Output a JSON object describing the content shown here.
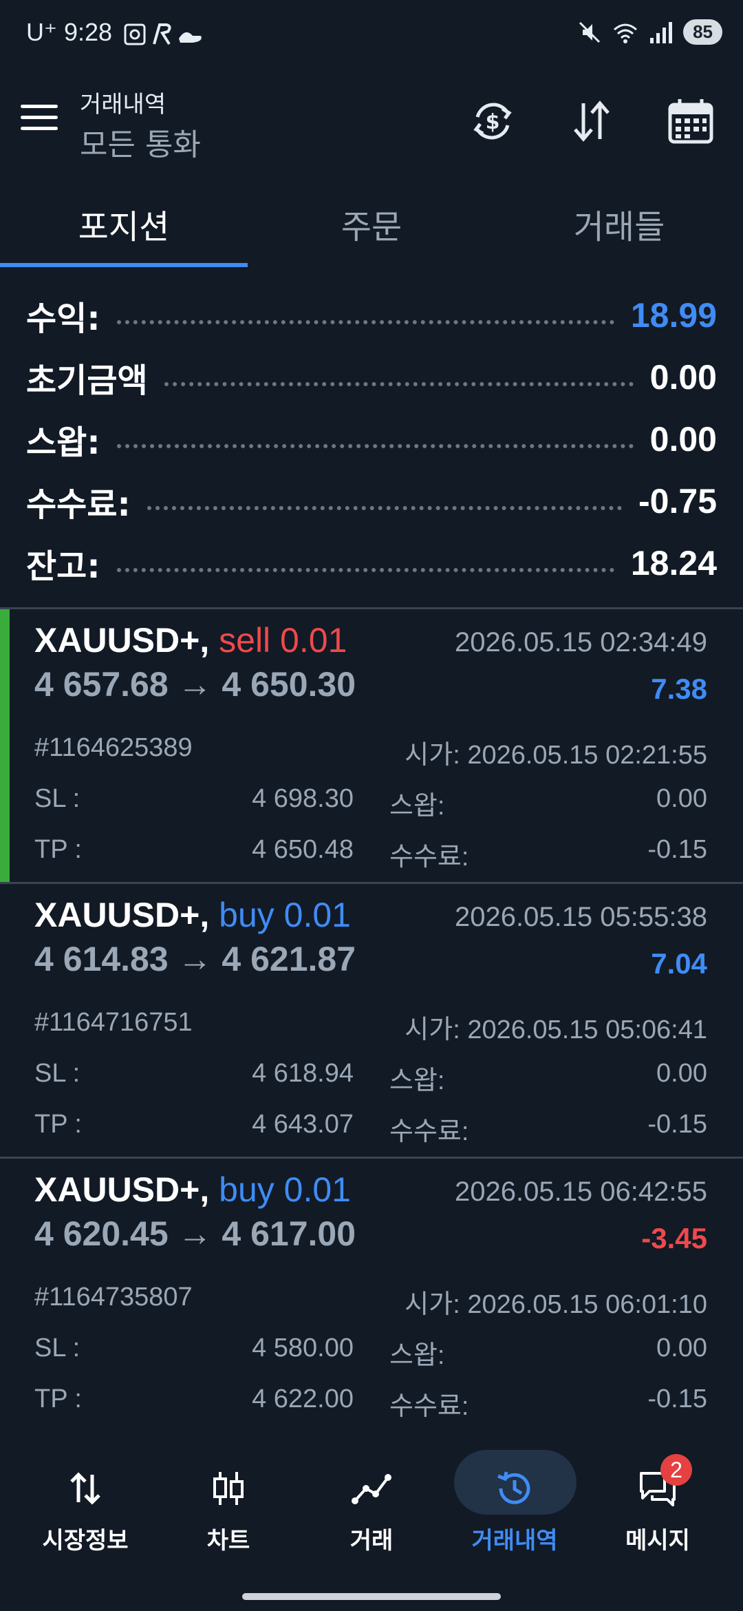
{
  "status_bar": {
    "carrier_time": "U⁺ 9:28",
    "battery": "85"
  },
  "header": {
    "title": "거래내역",
    "subtitle": "모든 통화"
  },
  "tabs": [
    {
      "label": "포지션",
      "active": true
    },
    {
      "label": "주문",
      "active": false
    },
    {
      "label": "거래들",
      "active": false
    }
  ],
  "summary": [
    {
      "label": "수익:",
      "value": "18.99"
    },
    {
      "label": "초기금액",
      "value": "0.00"
    },
    {
      "label": "스왑:",
      "value": "0.00"
    },
    {
      "label": "수수료:",
      "value": "-0.75"
    },
    {
      "label": "잔고:",
      "value": "18.24"
    }
  ],
  "positions": [
    {
      "symbol": "XAUUSD+,",
      "side": "sell 0.01",
      "close_time": "2026.05.15 02:34:49",
      "prices": "4 657.68 → 4 650.30",
      "profit": "7.38",
      "ticket": "#1164625389",
      "open_time": "시가: 2026.05.15 02:21:55",
      "sl_label": "SL :",
      "sl": "4 698.30",
      "tp_label": "TP :",
      "tp": "4 650.48",
      "swap_label": "스왑:",
      "swap": "0.00",
      "fee_label": "수수료:",
      "fee": "-0.15"
    },
    {
      "symbol": "XAUUSD+,",
      "side": "buy 0.01",
      "close_time": "2026.05.15 05:55:38",
      "prices": "4 614.83 → 4 621.87",
      "profit": "7.04",
      "ticket": "#1164716751",
      "open_time": "시가: 2026.05.15 05:06:41",
      "sl_label": "SL :",
      "sl": "4 618.94",
      "tp_label": "TP :",
      "tp": "4 643.07",
      "swap_label": "스왑:",
      "swap": "0.00",
      "fee_label": "수수료:",
      "fee": "-0.15"
    },
    {
      "symbol": "XAUUSD+,",
      "side": "buy 0.01",
      "close_time": "2026.05.15 06:42:55",
      "prices": "4 620.45 → 4 617.00",
      "profit": "-3.45",
      "ticket": "#1164735807",
      "open_time": "시가: 2026.05.15 06:01:10",
      "sl_label": "SL :",
      "sl": "4 580.00",
      "tp_label": "TP :",
      "tp": "4 622.00",
      "swap_label": "스왑:",
      "swap": "0.00",
      "fee_label": "수수료:",
      "fee": "-0.15"
    }
  ],
  "bottom_nav": [
    {
      "label": "시장정보",
      "icon": "quotes-arrows-icon"
    },
    {
      "label": "차트",
      "icon": "candlestick-icon"
    },
    {
      "label": "거래",
      "icon": "trade-line-icon"
    },
    {
      "label": "거래내역",
      "icon": "history-clock-icon",
      "active": true
    },
    {
      "label": "메시지",
      "icon": "messages-icon"
    }
  ],
  "messages_badge": "2",
  "colors": {
    "background": "#121a25",
    "accent_blue": "#3f8cf5",
    "loss_red": "#f0494c",
    "sell_bar_green": "#3aac3c"
  }
}
